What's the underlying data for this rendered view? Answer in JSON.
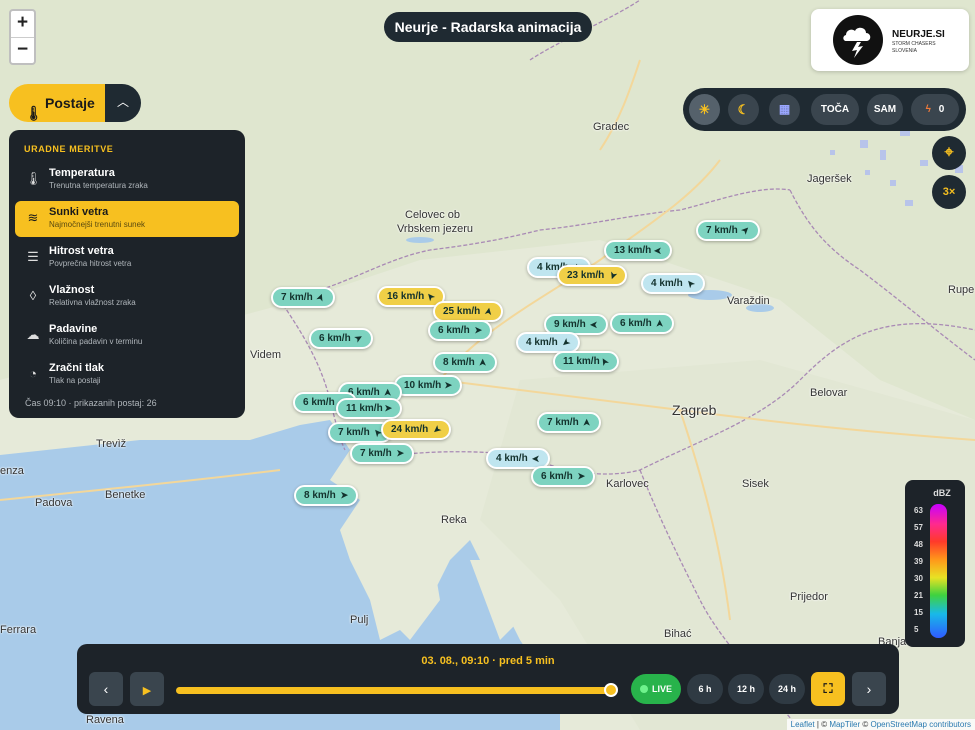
{
  "map": {
    "zoom_in": "+",
    "zoom_out": "−",
    "cities": [
      {
        "name": "Gradec"
      },
      {
        "name": "Jageršek"
      },
      {
        "name": "Celovec ob"
      },
      {
        "name": "Vrbskem jezeru"
      },
      {
        "name": "Varaždin"
      },
      {
        "name": "Rupe"
      },
      {
        "name": "Videm"
      },
      {
        "name": "Zagreb"
      },
      {
        "name": "Belovar"
      },
      {
        "name": "Trevìž"
      },
      {
        "name": "Benetke"
      },
      {
        "name": "Padova"
      },
      {
        "name": "enza"
      },
      {
        "name": "Karlovec"
      },
      {
        "name": "Sisek"
      },
      {
        "name": "Reka"
      },
      {
        "name": "Prijedor"
      },
      {
        "name": "Pulj"
      },
      {
        "name": "Bihać"
      },
      {
        "name": "Banja Luka"
      },
      {
        "name": "Ferrara"
      },
      {
        "name": "Ravena"
      }
    ]
  },
  "header": {
    "title": "Neurje - Radarska animacija"
  },
  "logo": {
    "name": "NEURJE.SI",
    "tagline_1": "STORM CHASERS",
    "tagline_2": "SLOVENIA"
  },
  "stations": {
    "button_label": "Postaje",
    "toggle_icon": "chevron-up",
    "section_title": "URADNE MERITVE",
    "items": [
      {
        "label": "Temperatura",
        "sub": "Trenutna temperatura zraka",
        "icon": "thermometer-icon",
        "active": false
      },
      {
        "label": "Sunki vetra",
        "sub": "Najmočnejši trenutni sunek",
        "icon": "wind-gust-icon",
        "active": true
      },
      {
        "label": "Hitrost vetra",
        "sub": "Povprečna hitrost vetra",
        "icon": "wind-speed-icon",
        "active": false
      },
      {
        "label": "Vlažnost",
        "sub": "Relativna vlažnost zraka",
        "icon": "droplet-icon",
        "active": false
      },
      {
        "label": "Padavine",
        "sub": "Količina padavin v terminu",
        "icon": "rain-cloud-icon",
        "active": false
      },
      {
        "label": "Zračni tlak",
        "sub": "Tlak na postaji",
        "icon": "gauge-icon",
        "active": false
      }
    ],
    "footer": "Čas 09:10 · prikazanih postaj: 26"
  },
  "toolbar": {
    "day_icon": "sun-icon",
    "night_icon": "moon-icon",
    "calendar_icon": "calendar-icon",
    "hail_label": "TOČA",
    "sam_label": "SAM",
    "lightning_count": "0",
    "speed_label": "3×"
  },
  "markers": [
    {
      "text": "7 km/h",
      "kind": "t",
      "dir": 45
    },
    {
      "text": "13 km/h",
      "kind": "t",
      "dir": 270
    },
    {
      "text": "4 km/h",
      "kind": "l",
      "dir": 0
    },
    {
      "text": "23 km/h",
      "kind": "y",
      "dir": 200
    },
    {
      "text": "4 km/h",
      "kind": "l",
      "dir": 320
    },
    {
      "text": "7 km/h",
      "kind": "t",
      "dir": 20
    },
    {
      "text": "16 km/h",
      "kind": "y",
      "dir": 320
    },
    {
      "text": "25 km/h",
      "kind": "y",
      "dir": 10
    },
    {
      "text": "6 km/h",
      "kind": "t",
      "dir": 60
    },
    {
      "text": "6 km/h",
      "kind": "t",
      "dir": 90
    },
    {
      "text": "9 km/h",
      "kind": "t",
      "dir": 270
    },
    {
      "text": "6 km/h",
      "kind": "t",
      "dir": 0
    },
    {
      "text": "4 km/h",
      "kind": "l",
      "dir": 230
    },
    {
      "text": "8 km/h",
      "kind": "t",
      "dir": 0
    },
    {
      "text": "11 km/h",
      "kind": "t",
      "dir": 330
    },
    {
      "text": "10 km/h",
      "kind": "t",
      "dir": 90
    },
    {
      "text": "6 km/h",
      "kind": "t",
      "dir": 0
    },
    {
      "text": "6 km/h",
      "kind": "t",
      "dir": 0
    },
    {
      "text": "11 km/h",
      "kind": "t",
      "dir": 90
    },
    {
      "text": "7 km/h",
      "kind": "t",
      "dir": 0
    },
    {
      "text": "7 km/h",
      "kind": "t",
      "dir": 320
    },
    {
      "text": "24 km/h",
      "kind": "y",
      "dir": 230
    },
    {
      "text": "7 km/h",
      "kind": "t",
      "dir": 90
    },
    {
      "text": "4 km/h",
      "kind": "l",
      "dir": 270
    },
    {
      "text": "6 km/h",
      "kind": "t",
      "dir": 90
    },
    {
      "text": "8 km/h",
      "kind": "t",
      "dir": 90
    }
  ],
  "legend": {
    "title": "dBZ",
    "values": [
      "63",
      "57",
      "48",
      "39",
      "30",
      "21",
      "15",
      "5"
    ]
  },
  "timeline": {
    "datetime": "03. 08., 09:10 · pred 5 min",
    "progress": 1.0,
    "live_label": "LIVE",
    "ranges": [
      "6 h",
      "12 h",
      "24 h"
    ]
  },
  "attribution": {
    "leaflet": "Leaflet",
    "sep1": "| © ",
    "maptiler": "MapTiler",
    "sep2": " © ",
    "osm": "OpenStreetMap contributors"
  }
}
